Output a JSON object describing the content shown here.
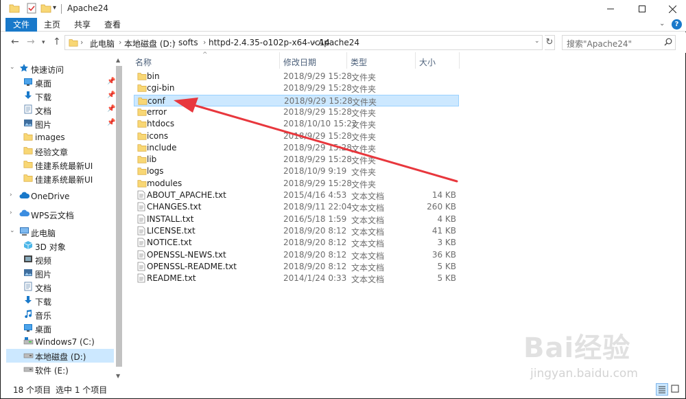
{
  "window": {
    "title": "Apache24"
  },
  "ribbon": {
    "tabs": [
      {
        "label": "文件"
      },
      {
        "label": "主页"
      },
      {
        "label": "共享"
      },
      {
        "label": "查看"
      }
    ],
    "help_label": "?"
  },
  "address": {
    "crumbs": [
      "此电脑",
      "本地磁盘 (D:)",
      "softs",
      "httpd-2.4.35-o102p-x64-vc14",
      "Apache24"
    ]
  },
  "search": {
    "placeholder": "搜索\"Apache24\""
  },
  "nav_pane": {
    "items": [
      {
        "label": "快速访问",
        "icon": "star-icon"
      },
      {
        "label": "桌面",
        "icon": "desktop-icon"
      },
      {
        "label": "下载",
        "icon": "download-icon"
      },
      {
        "label": "文档",
        "icon": "documents-icon"
      },
      {
        "label": "图片",
        "icon": "pictures-icon"
      },
      {
        "label": "images",
        "icon": "folder-icon"
      },
      {
        "label": "经验文章",
        "icon": "folder-icon"
      },
      {
        "label": "佳建系统最新UI",
        "icon": "folder-icon"
      },
      {
        "label": "佳建系统最新UI",
        "icon": "folder-icon"
      },
      {
        "label": "OneDrive",
        "icon": "cloud-icon"
      },
      {
        "label": "WPS云文档",
        "icon": "wps-cloud-icon"
      },
      {
        "label": "此电脑",
        "icon": "computer-icon"
      },
      {
        "label": "3D 对象",
        "icon": "3d-objects-icon"
      },
      {
        "label": "视频",
        "icon": "video-icon"
      },
      {
        "label": "图片",
        "icon": "pictures-icon"
      },
      {
        "label": "文档",
        "icon": "documents-icon"
      },
      {
        "label": "下载",
        "icon": "download-icon"
      },
      {
        "label": "音乐",
        "icon": "music-icon"
      },
      {
        "label": "桌面",
        "icon": "desktop-icon"
      },
      {
        "label": "Windows7 (C:)",
        "icon": "drive-c-icon"
      },
      {
        "label": "本地磁盘 (D:)",
        "icon": "drive-icon"
      },
      {
        "label": "软件 (E:)",
        "icon": "drive-icon"
      }
    ]
  },
  "columns": {
    "name": "名称",
    "modified": "修改日期",
    "type": "类型",
    "size": "大小"
  },
  "files": [
    {
      "name": "bin",
      "modified": "2018/9/29 15:28",
      "type": "文件夹",
      "size": "",
      "kind": "folder"
    },
    {
      "name": "cgi-bin",
      "modified": "2018/9/29 15:28",
      "type": "文件夹",
      "size": "",
      "kind": "folder"
    },
    {
      "name": "conf",
      "modified": "2018/9/29 15:28",
      "type": "文件夹",
      "size": "",
      "kind": "folder"
    },
    {
      "name": "error",
      "modified": "2018/9/29 15:28",
      "type": "文件夹",
      "size": "",
      "kind": "folder"
    },
    {
      "name": "htdocs",
      "modified": "2018/10/10 15:22",
      "type": "文件夹",
      "size": "",
      "kind": "folder"
    },
    {
      "name": "icons",
      "modified": "2018/9/29 15:28",
      "type": "文件夹",
      "size": "",
      "kind": "folder"
    },
    {
      "name": "include",
      "modified": "2018/9/29 15:28",
      "type": "文件夹",
      "size": "",
      "kind": "folder"
    },
    {
      "name": "lib",
      "modified": "2018/9/29 15:28",
      "type": "文件夹",
      "size": "",
      "kind": "folder"
    },
    {
      "name": "logs",
      "modified": "2018/10/9 9:19",
      "type": "文件夹",
      "size": "",
      "kind": "folder"
    },
    {
      "name": "modules",
      "modified": "2018/9/29 15:28",
      "type": "文件夹",
      "size": "",
      "kind": "folder"
    },
    {
      "name": "ABOUT_APACHE.txt",
      "modified": "2015/4/16 4:53",
      "type": "文本文档",
      "size": "14 KB",
      "kind": "text"
    },
    {
      "name": "CHANGES.txt",
      "modified": "2018/9/11 22:04",
      "type": "文本文档",
      "size": "260 KB",
      "kind": "text"
    },
    {
      "name": "INSTALL.txt",
      "modified": "2016/5/18 1:59",
      "type": "文本文档",
      "size": "4 KB",
      "kind": "text"
    },
    {
      "name": "LICENSE.txt",
      "modified": "2018/9/20 8:12",
      "type": "文本文档",
      "size": "41 KB",
      "kind": "text"
    },
    {
      "name": "NOTICE.txt",
      "modified": "2018/9/20 8:12",
      "type": "文本文档",
      "size": "3 KB",
      "kind": "text"
    },
    {
      "name": "OPENSSL-NEWS.txt",
      "modified": "2018/9/20 8:12",
      "type": "文本文档",
      "size": "36 KB",
      "kind": "text"
    },
    {
      "name": "OPENSSL-README.txt",
      "modified": "2018/9/20 8:12",
      "type": "文本文档",
      "size": "5 KB",
      "kind": "text"
    },
    {
      "name": "README.txt",
      "modified": "2014/1/24 0:33",
      "type": "文本文档",
      "size": "5 KB",
      "kind": "text"
    }
  ],
  "selected_file": "conf",
  "status": {
    "count": "18 个项目",
    "selection": "选中 1 个项目"
  },
  "watermark": {
    "brand": "Bai经验",
    "url": "jingyan.baidu.com"
  },
  "colors": {
    "accent": "#1979ca",
    "selection": "#cce8ff",
    "folder": "#f8d775",
    "arrow": "#e8373d"
  }
}
